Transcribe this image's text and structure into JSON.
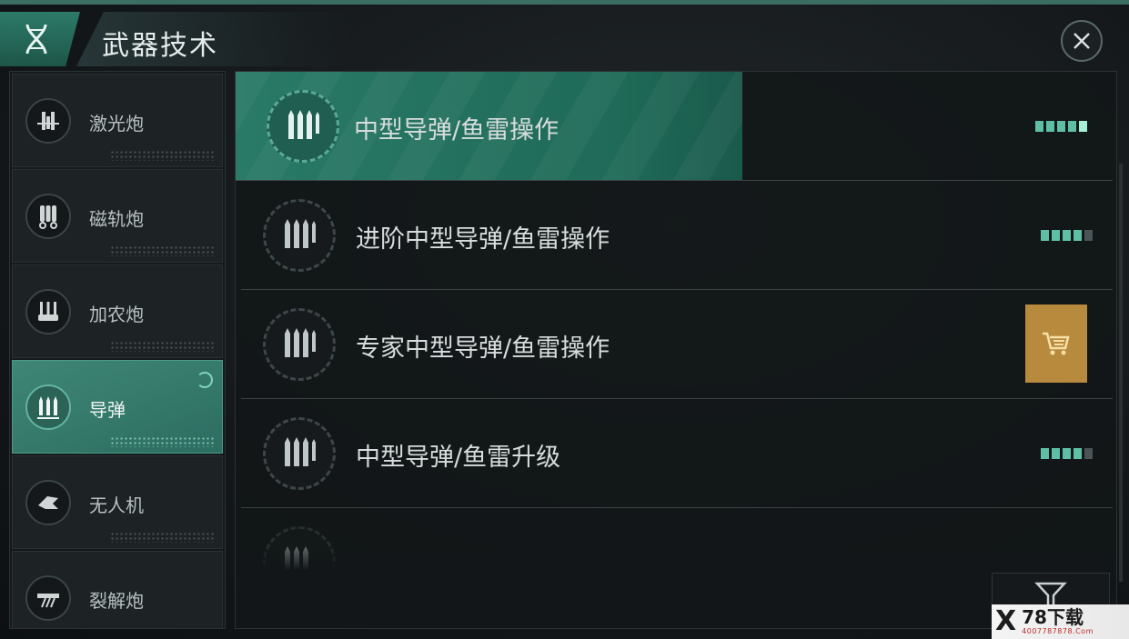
{
  "header": {
    "title": "武器技术"
  },
  "sidebar": {
    "items": [
      {
        "label": "激光炮"
      },
      {
        "label": "磁轨炮"
      },
      {
        "label": "加农炮"
      },
      {
        "label": "导弹"
      },
      {
        "label": "无人机"
      },
      {
        "label": "裂解炮"
      }
    ],
    "active_index": 3
  },
  "tech_list": {
    "items": [
      {
        "label": "中型导弹/鱼雷操作",
        "level": 5,
        "max_level": 5,
        "state": "selected"
      },
      {
        "label": "进阶中型导弹/鱼雷操作",
        "level": 4,
        "max_level": 5,
        "state": "normal"
      },
      {
        "label": "专家中型导弹/鱼雷操作",
        "state": "purchase"
      },
      {
        "label": "中型导弹/鱼雷升级",
        "level": 4,
        "max_level": 5,
        "state": "normal"
      }
    ]
  },
  "watermark": {
    "logo": "X",
    "main": "78下载",
    "sub": "4007787878.Com"
  },
  "colors": {
    "accent": "#2a7a68",
    "level_on": "#5fbfa6",
    "level_off": "#4a5355",
    "shop": "#b88a3e"
  }
}
